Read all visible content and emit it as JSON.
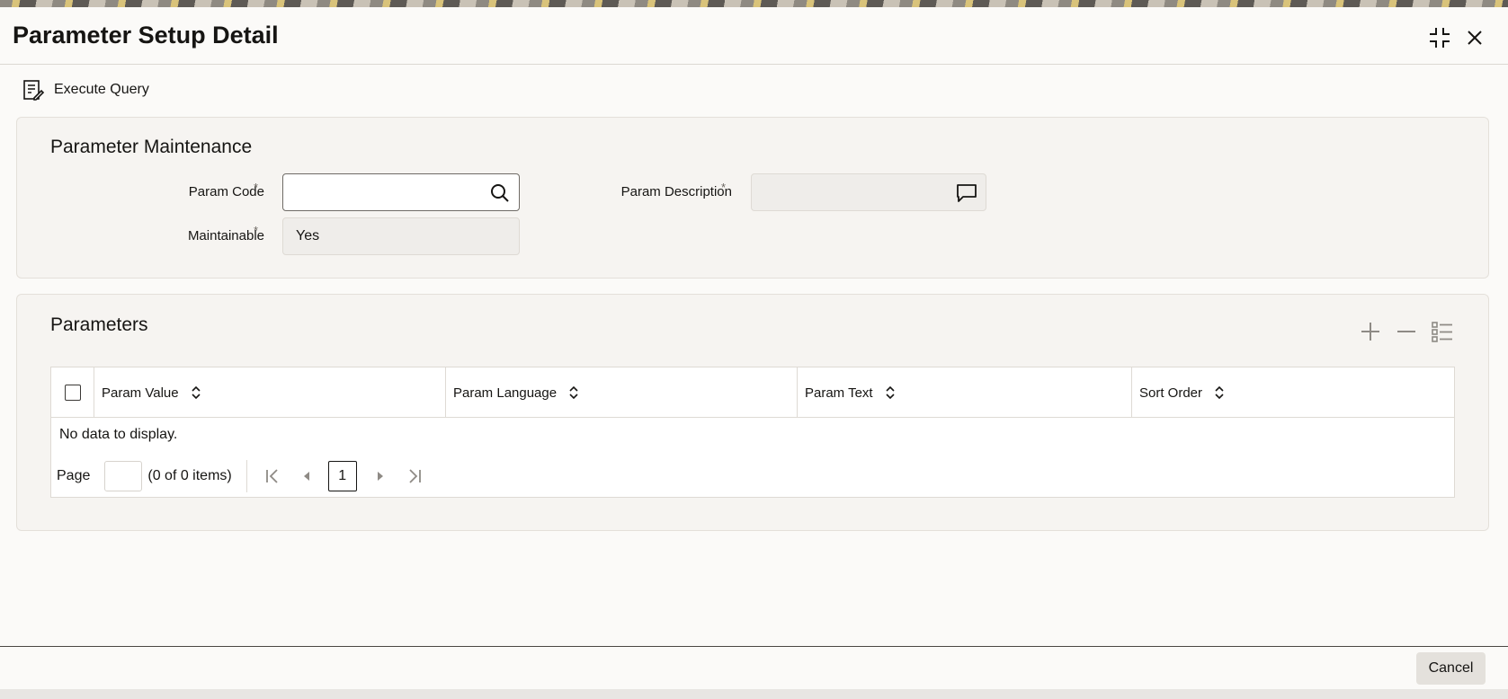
{
  "header": {
    "title": "Parameter Setup Detail",
    "icons": {
      "minimize": "collapse-icon",
      "close": "close-icon"
    }
  },
  "toolbar": {
    "execute_query_label": "Execute Query",
    "execute_query_icon": "query-edit-icon"
  },
  "maintenance": {
    "title": "Parameter Maintenance",
    "param_code": {
      "label": "Param Code",
      "required": "*",
      "value": "",
      "icon": "search-icon"
    },
    "param_description": {
      "label": "Param Description",
      "required": "*",
      "value": "",
      "icon": "comment-icon"
    },
    "maintainable": {
      "label": "Maintainable",
      "required": "*",
      "value": "Yes"
    }
  },
  "parameters": {
    "title": "Parameters",
    "actions": [
      "add-icon",
      "remove-icon",
      "list-icon"
    ],
    "columns": [
      {
        "label": "Param Value"
      },
      {
        "label": "Param Language"
      },
      {
        "label": "Param Text"
      },
      {
        "label": "Sort Order"
      }
    ],
    "rows": [],
    "empty_text": "No data to display.",
    "pager": {
      "page_label": "Page",
      "page_input": "",
      "count": "(0 of 0 items)",
      "current_page": "1"
    }
  },
  "footer": {
    "cancel_label": "Cancel"
  },
  "colors": {
    "text": "#161513",
    "panel": "#f6f4f1",
    "border": "#dedad4",
    "button": "#e4e1dc"
  }
}
